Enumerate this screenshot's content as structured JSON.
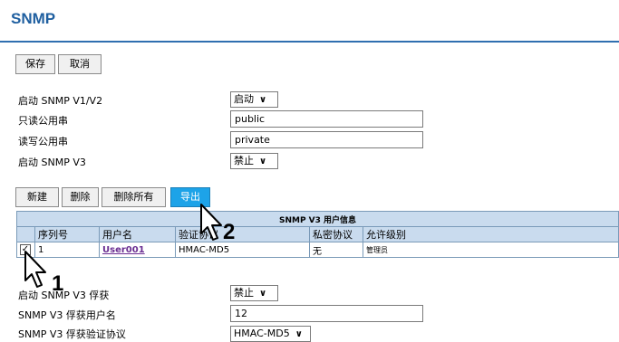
{
  "page": {
    "title": "SNMP"
  },
  "top_buttons": {
    "save": "保存",
    "cancel": "取消"
  },
  "settings": {
    "snmp_v1v2_label": "启动 SNMP V1/V2",
    "snmp_v1v2_value": "启动",
    "read_community_label": "只读公用串",
    "read_community_value": "public",
    "write_community_label": "读写公用串",
    "write_community_value": "private",
    "snmp_v3_label": "启动 SNMP V3",
    "snmp_v3_value": "禁止"
  },
  "user_toolbar": {
    "new": "新建",
    "delete": "删除",
    "delete_all": "删除所有",
    "export": "导出"
  },
  "user_table": {
    "caption": "SNMP V3 用户信息",
    "headers": [
      "序列号",
      "用户名",
      "验证协议",
      "私密协议",
      "允许级别"
    ],
    "rows": [
      {
        "checked": "✓",
        "index": "1",
        "username": "User001",
        "auth": "HMAC-MD5",
        "privacy": "无",
        "level": "管理员"
      }
    ]
  },
  "trap": {
    "v3_trap_label": "启动 SNMP V3 俘获",
    "v3_trap_value": "禁止",
    "trap_user_label": "SNMP V3 俘获用户名",
    "trap_user_value": "12",
    "trap_auth_label": "SNMP V3 俘获验证协议",
    "trap_auth_value": "HMAC-MD5"
  },
  "callouts": {
    "step1": "1",
    "step2": "2"
  }
}
